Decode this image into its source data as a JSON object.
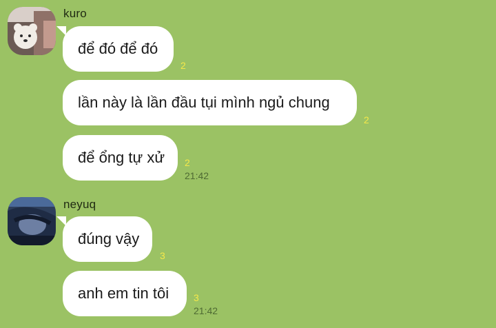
{
  "conversation": [
    {
      "sender": "kuro",
      "avatar_icon": "avatar-kuro-photo",
      "messages": [
        {
          "text": "để đó để đó",
          "read_count": "2"
        },
        {
          "text": "lần này là lần đầu tụi mình ngủ chung",
          "read_count": "2"
        },
        {
          "text": "để ổng tự xử",
          "read_count": "2",
          "time": "21:42"
        }
      ]
    },
    {
      "sender": "neyuq",
      "avatar_icon": "avatar-neyuq-photo",
      "messages": [
        {
          "text": "đúng vậy",
          "read_count": "3"
        },
        {
          "text": "anh em tin tôi",
          "read_count": "3",
          "time": "21:42"
        }
      ]
    }
  ],
  "colors": {
    "background": "#9bc264",
    "bubble": "#ffffff",
    "read_count": "#f5e84a",
    "timestamp": "#4e6a33"
  }
}
